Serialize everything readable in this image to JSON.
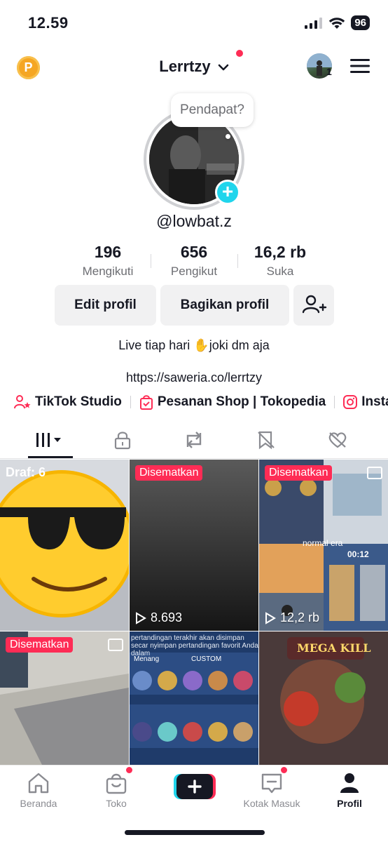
{
  "status_bar": {
    "time": "12.59",
    "battery": "96"
  },
  "header": {
    "coin_letter": "P",
    "username": "Lerrtzy",
    "account_count": "1"
  },
  "profile": {
    "bubble_text": "Pendapat?",
    "handle": "@lowbat.z",
    "stats": [
      {
        "value": "196",
        "label": "Mengikuti"
      },
      {
        "value": "656",
        "label": "Pengikut"
      },
      {
        "value": "16,2 rb",
        "label": "Suka"
      }
    ],
    "edit_button": "Edit profil",
    "share_button": "Bagikan profil",
    "bio": "Live tiap hari ✋️joki dm aja",
    "link": "https://saweria.co/lerrtzy"
  },
  "quick_links": [
    {
      "label": "TikTok Studio",
      "icon": "person-star-icon"
    },
    {
      "label": "Pesanan Shop | Tokopedia",
      "icon": "shopping-bag-icon"
    },
    {
      "label": "Instag",
      "icon": "instagram-icon"
    }
  ],
  "tabs": [
    "videos-grid-icon",
    "lock-icon",
    "repost-icon",
    "saved-icon",
    "liked-icon"
  ],
  "grid": {
    "draft_label": "Draf: 6",
    "pinned_label": "Disematkan",
    "video1_views": "8.693",
    "video2_views": "12,2 rb",
    "overlay_normal": "normal era",
    "overlay_time": "00:12",
    "overlay_menang": "Menang",
    "overlay_custom": "CUSTOM",
    "overlay_text": "pertandingan terakhir akan disimpan secar nyimpan pertandingan favorit Anda dalam",
    "overlay_megakill": "MEGA KILL"
  },
  "bottom_nav": [
    {
      "label": "Beranda",
      "icon": "home-icon"
    },
    {
      "label": "Toko",
      "icon": "shop-bag-icon"
    },
    {
      "label": "",
      "icon": "create-plus-icon"
    },
    {
      "label": "Kotak Masuk",
      "icon": "inbox-icon"
    },
    {
      "label": "Profil",
      "icon": "profile-icon"
    }
  ],
  "colors": {
    "accent": "#fe2c55",
    "cyan": "#20d5ec",
    "text": "#161823",
    "secondary": "#6c6d72"
  }
}
